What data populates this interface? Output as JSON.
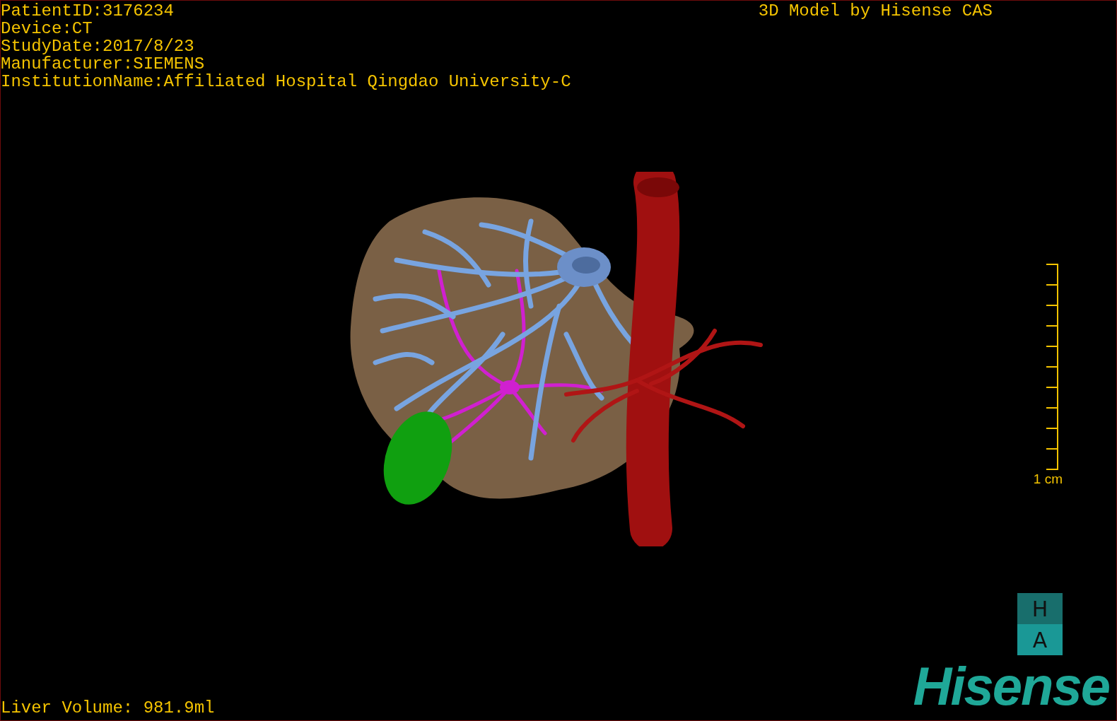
{
  "header": {
    "info_lines": [
      "PatientID:3176234",
      "Device:CT",
      "StudyDate:2017/8/23",
      "Manufacturer:SIEMENS",
      "InstitutionName:Affiliated Hospital Qingdao University-C"
    ],
    "title": "3D Model by Hisense CAS"
  },
  "scale_bar": {
    "label": "1 cm"
  },
  "orientation_marker": {
    "top": "H",
    "bottom": "A"
  },
  "logo": "Hisense",
  "footer": {
    "volume": "Liver Volume: 981.9ml"
  }
}
